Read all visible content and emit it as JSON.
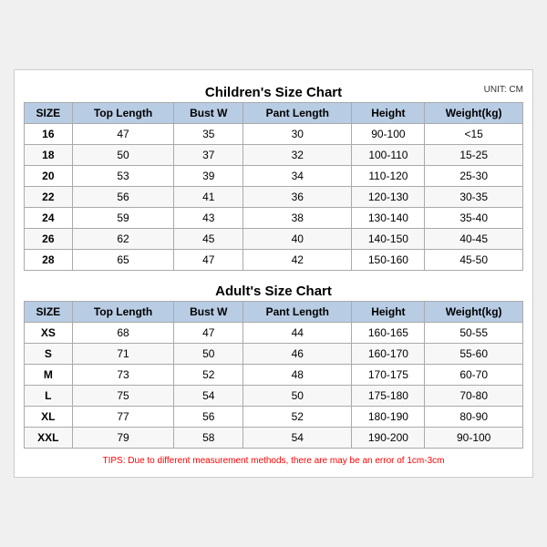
{
  "children_title": "Children's Size Chart",
  "adult_title": "Adult's Size Chart",
  "unit_label": "UNIT: CM",
  "tips": "TIPS: Due to different measurement methods, there are may be an error of 1cm-3cm",
  "headers": [
    "SIZE",
    "Top Length",
    "Bust W",
    "Pant Length",
    "Height",
    "Weight(kg)"
  ],
  "children_rows": [
    [
      "16",
      "47",
      "35",
      "30",
      "90-100",
      "<15"
    ],
    [
      "18",
      "50",
      "37",
      "32",
      "100-110",
      "15-25"
    ],
    [
      "20",
      "53",
      "39",
      "34",
      "110-120",
      "25-30"
    ],
    [
      "22",
      "56",
      "41",
      "36",
      "120-130",
      "30-35"
    ],
    [
      "24",
      "59",
      "43",
      "38",
      "130-140",
      "35-40"
    ],
    [
      "26",
      "62",
      "45",
      "40",
      "140-150",
      "40-45"
    ],
    [
      "28",
      "65",
      "47",
      "42",
      "150-160",
      "45-50"
    ]
  ],
  "adult_rows": [
    [
      "XS",
      "68",
      "47",
      "44",
      "160-165",
      "50-55"
    ],
    [
      "S",
      "71",
      "50",
      "46",
      "160-170",
      "55-60"
    ],
    [
      "M",
      "73",
      "52",
      "48",
      "170-175",
      "60-70"
    ],
    [
      "L",
      "75",
      "54",
      "50",
      "175-180",
      "70-80"
    ],
    [
      "XL",
      "77",
      "56",
      "52",
      "180-190",
      "80-90"
    ],
    [
      "XXL",
      "79",
      "58",
      "54",
      "190-200",
      "90-100"
    ]
  ]
}
